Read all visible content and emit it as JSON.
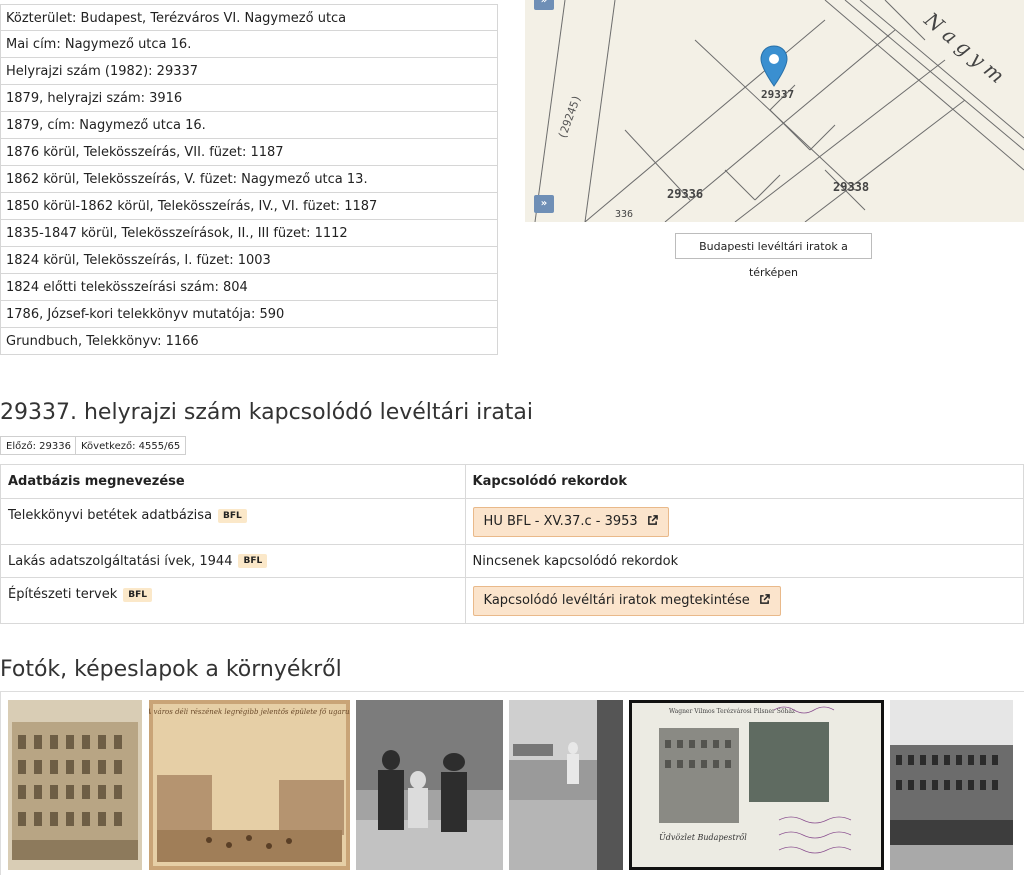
{
  "info": {
    "rows": [
      "Közterület: Budapest, Terézváros VI. Nagymező utca",
      "Mai cím: Nagymező utca 16.",
      "Helyrajzi szám (1982): 29337",
      "1879, helyrajzi szám: 3916",
      "1879, cím: Nagymező utca 16.",
      "1876 körül, Telekösszeírás, VII. füzet: 1187",
      "1862 körül, Telekösszeírás, V. füzet: Nagymező utca 13.",
      "1850 körül-1862 körül, Telekösszeírás, IV., VI. füzet: 1187",
      "1835-1847 körül, Telekösszeírások, II., III füzet: 1112",
      "1824 körül, Telekösszeírás, I. füzet: 1003",
      "1824 előtti telekösszeírási szám: 804",
      "1786, József-kori telekkönyv mutatója: 590",
      "Grundbuch, Telekkönyv: 1166"
    ]
  },
  "map": {
    "labels": [
      "29337",
      "29336",
      "29338",
      "(29245)",
      "336",
      "Nagym"
    ],
    "expand_label": "»",
    "link_label": "Budapesti levéltári iratok a térképen"
  },
  "archive": {
    "heading": "29337. helyrajzi szám kapcsolódó levéltári iratai",
    "prev": "Előző: 29336",
    "next": "Következő: 4555/65",
    "col_db": "Adatbázis megnevezése",
    "col_rec": "Kapcsolódó rekordok",
    "rows": [
      {
        "name": "Telekkönyvi betétek adatbázisa",
        "badge": "BFL",
        "record": "HU BFL - XV.37.c - 3953",
        "is_button": true
      },
      {
        "name": "Lakás adatszolgáltatási ívek, 1944",
        "badge": "BFL",
        "record": "Nincsenek kapcsolódó rekordok",
        "is_button": false
      },
      {
        "name": "Építészeti tervek",
        "badge": "BFL",
        "record": "Kapcsolódó levéltári iratok megtekintése",
        "is_button": true
      }
    ]
  },
  "photos": {
    "heading": "Fotók, képeslapok a környékről",
    "captions": [
      "A város déli részének legrégibb jelentős épülete fő ugarul",
      "Wagner Vilmos Terézvárosi Pilsner Söház",
      "Üdvözlet Budapestről"
    ]
  },
  "colors": {
    "badge_bg": "#fbe8c9",
    "button_bg": "#fbe4cc",
    "map_bg": "#f3f0e6",
    "map_pin": "#3a8fd0"
  }
}
